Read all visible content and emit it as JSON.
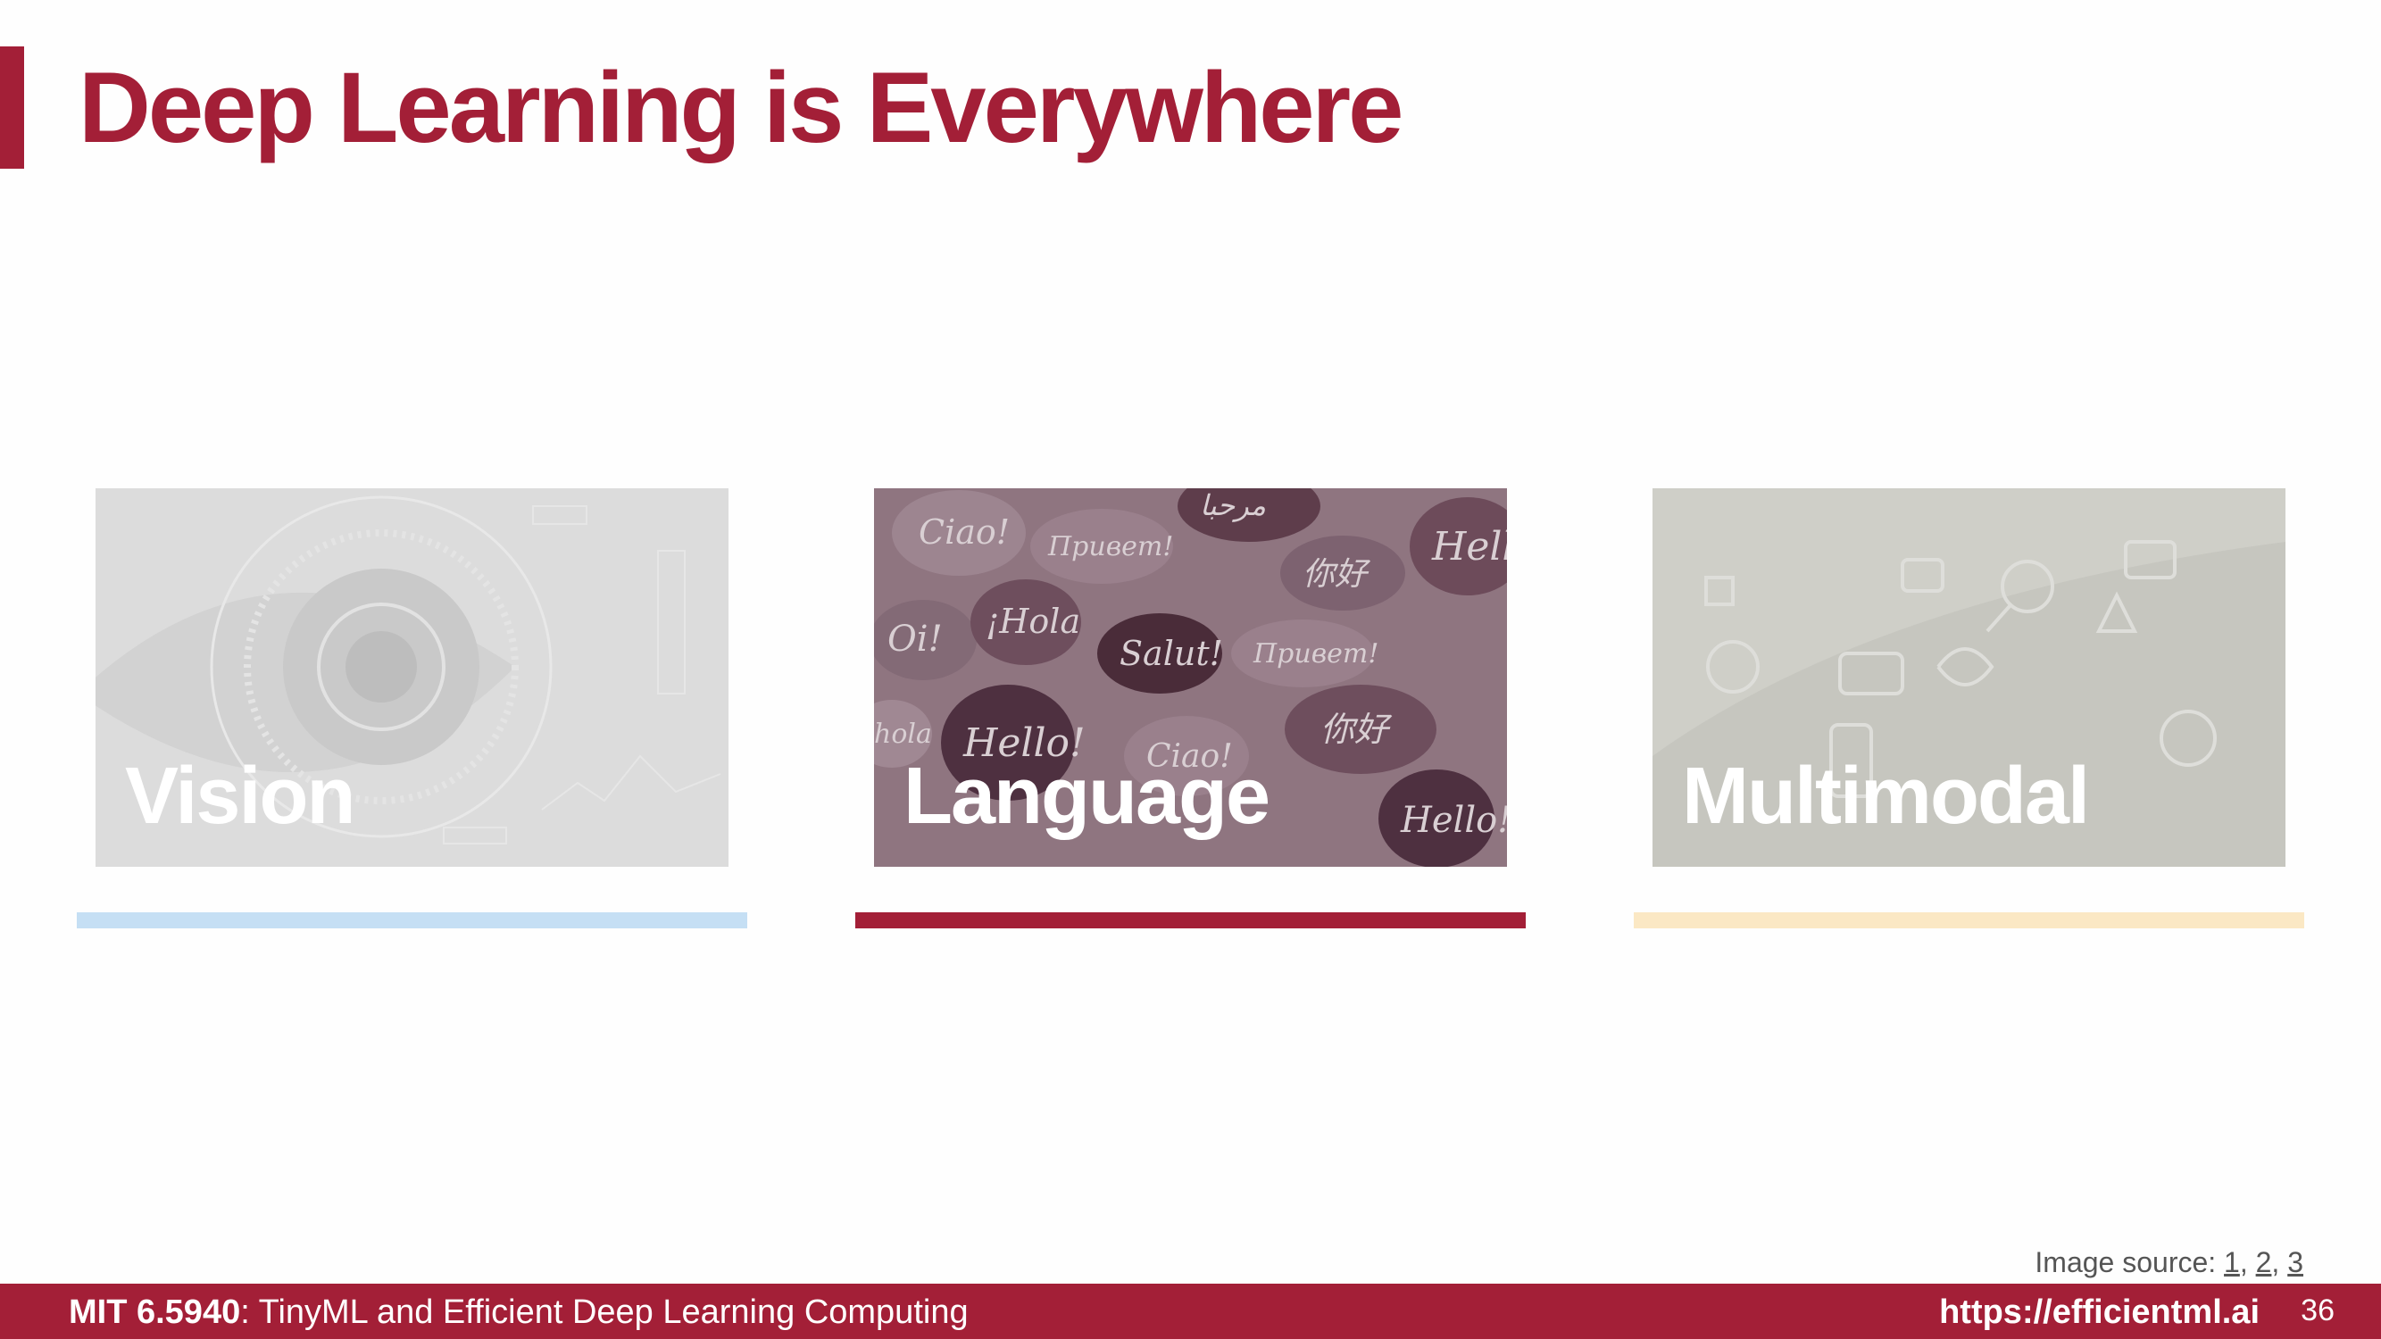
{
  "slide": {
    "title": "Deep Learning is Everywhere",
    "page_number": "36"
  },
  "cards": [
    {
      "label": "Vision",
      "underline_color": "#c5dff4",
      "tint": "#dcdcdc"
    },
    {
      "label": "Language",
      "underline_color": "#a31f37",
      "tint": "#8f7580"
    },
    {
      "label": "Multimodal",
      "underline_color": "#fbe8c4",
      "tint": "#cfcfc8"
    }
  ],
  "language_bubbles": [
    "Ciao!",
    "Привет!",
    "مرحبا",
    "Hell",
    "Oi!",
    "¡Hola",
    "Salut!",
    "Привет!",
    "你好",
    "Hello!",
    "Ciao!",
    "你好",
    "Hello!",
    "hola"
  ],
  "image_source": {
    "prefix": "Image source: ",
    "links": [
      "1",
      "2",
      "3"
    ]
  },
  "footer": {
    "course_code": "MIT 6.5940",
    "course_name": ": TinyML and Efficient Deep Learning Computing",
    "url": "https://efficientml.ai"
  }
}
